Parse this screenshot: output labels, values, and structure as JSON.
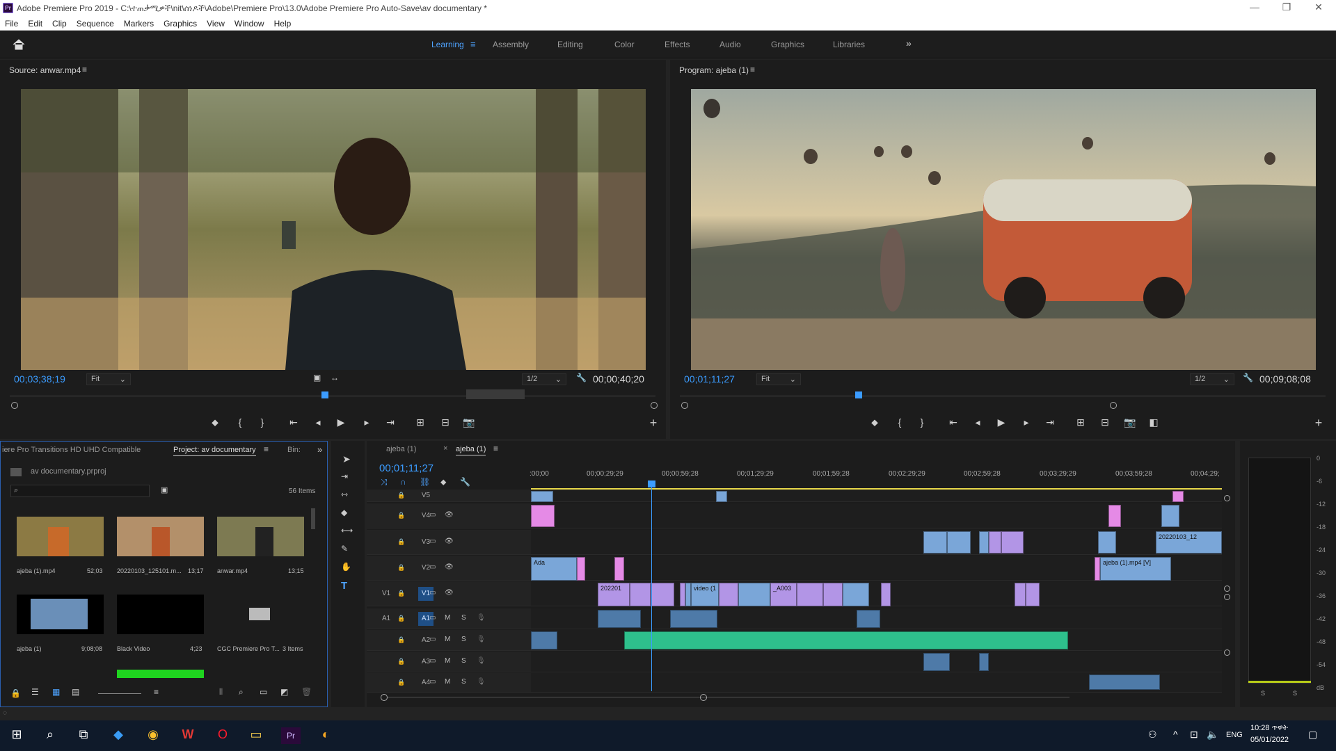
{
  "app": {
    "title": "Adobe Premiere Pro 2019 - C:\\ተጠቃሚዎች\\nit\\ሰነዶች\\Adobe\\Premiere Pro\\13.0\\Adobe Premiere Pro Auto-Save\\av documentary *",
    "icon": "Pr"
  },
  "menu": [
    "File",
    "Edit",
    "Clip",
    "Sequence",
    "Markers",
    "Graphics",
    "View",
    "Window",
    "Help"
  ],
  "workspaces": [
    "Learning",
    "Assembly",
    "Editing",
    "Color",
    "Effects",
    "Audio",
    "Graphics",
    "Libraries"
  ],
  "workspace_more": "»",
  "source": {
    "title": "Source: anwar.mp4",
    "timecode": "00;03;38;19",
    "fit": "Fit",
    "res": "1/2",
    "duration": "00;00;40;20"
  },
  "program": {
    "title": "Program: ajeba (1)",
    "timecode": "00;01;11;27",
    "fit": "Fit",
    "res": "1/2",
    "duration": "00;09;08;08"
  },
  "project": {
    "tab_left": "iere Pro Transitions HD UHD Compatible",
    "tab_active": "Project: av documentary",
    "tab_bin": "Bin:",
    "file": "av documentary.prproj",
    "items_count": "56 Items",
    "items": [
      {
        "name": "ajeba (1).mp4",
        "dur": "52;03"
      },
      {
        "name": "20220103_125101.m...",
        "dur": "13;17"
      },
      {
        "name": "anwar.mp4",
        "dur": "13;15"
      },
      {
        "name": "ajeba (1)",
        "dur": "9;08;08"
      },
      {
        "name": "Black Video",
        "dur": "4;23"
      },
      {
        "name": "CGC Premiere Pro T...",
        "dur": "3 Items"
      }
    ]
  },
  "timeline": {
    "tab1": "ajeba (1)",
    "tab2": "ajeba (1)",
    "timecode": "00;01;11;27",
    "ruler": [
      ":00;00",
      "00;00;29;29",
      "00;00;59;28",
      "00;01;29;29",
      "00;01;59;28",
      "00;02;29;29",
      "00;02;59;28",
      "00;03;29;29",
      "00;03;59;28",
      "00;04;29;"
    ],
    "video_tracks": [
      "V5",
      "V4",
      "V3",
      "V2",
      "V1"
    ],
    "audio_tracks": [
      "A1",
      "A2",
      "A3",
      "A4"
    ],
    "src_v": "V1",
    "src_a": "A1",
    "clip_labels": {
      "ada": "Ada",
      "c2022": "202201",
      "video1": "video (1",
      "a003": "_A003",
      "c20220103": "20220103_12",
      "ajeba": "ajeba (1).mp4 [V]"
    }
  },
  "meter": {
    "scale": [
      "0",
      "-6",
      "-12",
      "-18",
      "-24",
      "-30",
      "-36",
      "-42",
      "-48",
      "-54",
      "dB"
    ],
    "solo": [
      "S",
      "S"
    ]
  },
  "taskbar": {
    "lang": "ENG",
    "time": "10:28 ጥዋት",
    "date": "05/01/2022"
  }
}
